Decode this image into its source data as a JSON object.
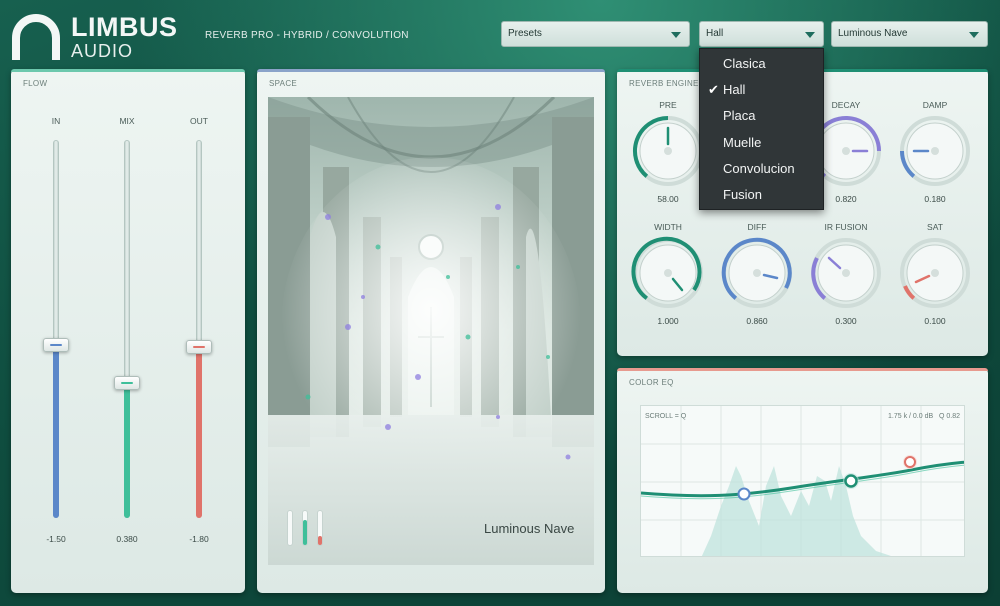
{
  "header": {
    "logo_word": "LIMBUS",
    "logo_sub": "AUDIO",
    "subtitle": "REVERB PRO  -  HYBRID / CONVOLUTION",
    "presets_select": "Presets",
    "type_select": "Hall",
    "ir_select": "Luminous Nave"
  },
  "type_menu": {
    "options": [
      "Clasica",
      "Hall",
      "Placa",
      "Muelle",
      "Convolucion",
      "Fusion"
    ],
    "selected": "Hall"
  },
  "flow": {
    "title": "FLOW",
    "sliders": [
      {
        "label": "IN",
        "value_text": "-1.50",
        "position": 0.62,
        "color": "#5b87c9"
      },
      {
        "label": "MIX",
        "value_text": "0.380",
        "position": 0.53,
        "color": "#3fbf9a"
      },
      {
        "label": "OUT",
        "value_text": "-1.80",
        "position": 0.62,
        "color": "#e0736a"
      }
    ]
  },
  "space": {
    "title": "SPACE",
    "ir_name": "Luminous Nave",
    "meters": [
      {
        "level": 0.0,
        "color": "#3fbf9a"
      },
      {
        "level": 0.7,
        "color": "#3fbf9a"
      },
      {
        "level": 0.25,
        "color": "#e0736a"
      }
    ]
  },
  "engine": {
    "title": "REVERB ENGINE",
    "knobs": [
      {
        "label": "PRE",
        "value_text": "58.00",
        "level": 0.5,
        "color": "#1f8f74"
      },
      {
        "label": "DECAY",
        "value_text": "0.820",
        "level": 0.75,
        "color": "#8a7fd6"
      },
      {
        "label": "DAMP",
        "value_text": "0.180",
        "level": 0.25,
        "color": "#5b87c9"
      },
      {
        "label": "WIDTH",
        "value_text": "1.000",
        "level": 0.88,
        "color": "#1f8f74"
      },
      {
        "label": "DIFF",
        "value_text": "0.860",
        "level": 0.85,
        "color": "#5b87c9"
      },
      {
        "label": "IR FUSION",
        "value_text": "0.300",
        "level": 0.32,
        "color": "#8a7fd6"
      },
      {
        "label": "SAT",
        "value_text": "0.100",
        "level": 0.15,
        "color": "#e0736a"
      }
    ]
  },
  "eq": {
    "title": "COLOR EQ",
    "hint": "SCROLL = Q",
    "readout": "1.75 k / 0.0 dB   Q 0.82"
  },
  "colors": {
    "accent_green": "#1f8f74",
    "accent_blue": "#5b87c9",
    "accent_red": "#e0736a",
    "accent_purple": "#8a7fd6"
  }
}
